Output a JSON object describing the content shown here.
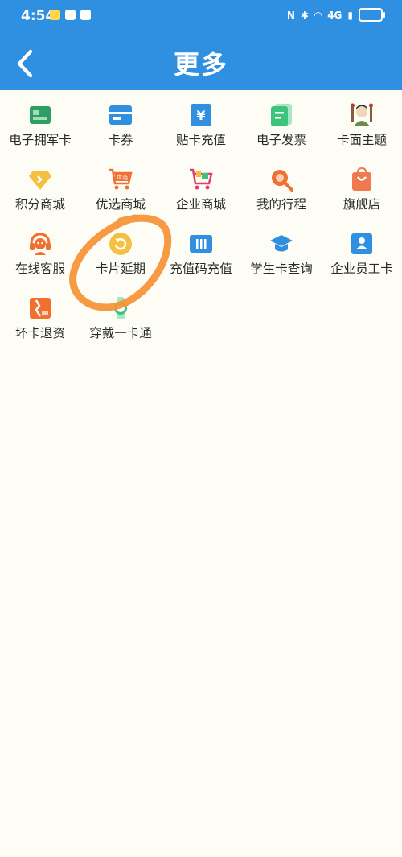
{
  "status_bar": {
    "time": "4:54",
    "network": "4G"
  },
  "header": {
    "title": "更多",
    "back_icon": "chevron-left-icon"
  },
  "grid": {
    "rows": [
      [
        {
          "label": "电子拥军卡",
          "icon": "military-card-icon",
          "color": "#2e9e63"
        },
        {
          "label": "卡券",
          "icon": "coupon-icon",
          "color": "#2f8fe0"
        },
        {
          "label": "贴卡充值",
          "icon": "yen-topup-icon",
          "color": "#2f8fe0"
        },
        {
          "label": "电子发票",
          "icon": "invoice-icon",
          "color": "#3cc47c"
        },
        {
          "label": "卡面主题",
          "icon": "theme-avatar-icon",
          "color": "#8a5a3c"
        }
      ],
      [
        {
          "label": "积分商城",
          "icon": "diamond-icon",
          "color": "#f5c040"
        },
        {
          "label": "优选商城",
          "icon": "shopping-cart-icon",
          "color": "#f07030"
        },
        {
          "label": "企业商城",
          "icon": "enterprise-cart-icon",
          "color": "#e04070"
        },
        {
          "label": "我的行程",
          "icon": "search-trip-icon",
          "color": "#f07030"
        },
        {
          "label": "旗舰店",
          "icon": "shopping-bag-icon",
          "color": "#f07a50"
        }
      ],
      [
        {
          "label": "在线客服",
          "icon": "headset-icon",
          "color": "#f07030"
        },
        {
          "label": "卡片延期",
          "icon": "refresh-icon",
          "color": "#f5c040"
        },
        {
          "label": "充值码充值",
          "icon": "topup-code-icon",
          "color": "#2f8fe0"
        },
        {
          "label": "学生卡查询",
          "icon": "graduation-cap-icon",
          "color": "#2f8fe0"
        },
        {
          "label": "企业员工卡",
          "icon": "employee-card-icon",
          "color": "#2f8fe0"
        }
      ],
      [
        {
          "label": "坏卡退资",
          "icon": "broken-card-icon",
          "color": "#f07030"
        },
        {
          "label": "穿戴一卡通",
          "icon": "watch-icon",
          "color": "#3cc47c"
        }
      ]
    ]
  },
  "annotation": {
    "color": "#f5953a"
  }
}
